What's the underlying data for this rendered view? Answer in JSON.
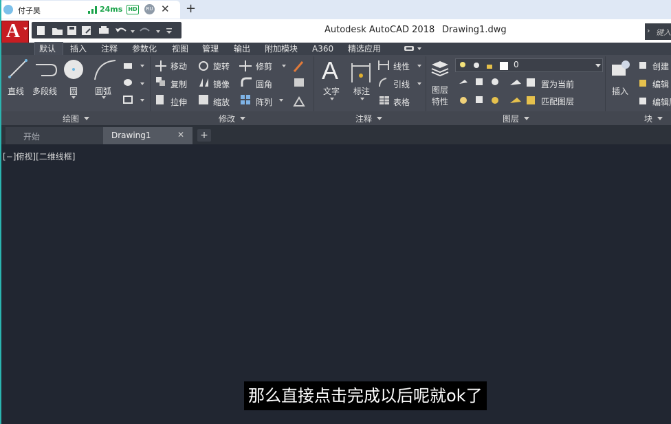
{
  "browser": {
    "tab_title": "付子昊",
    "latency": "24ms",
    "hd_badge": "HD",
    "region_badge": "RU",
    "close_glyph": "✕",
    "new_tab_glyph": "+"
  },
  "title_bar": {
    "app_title": "Autodesk AutoCAD 2018",
    "document_title": "Drawing1.dwg",
    "app_button_letter": "A",
    "search_placeholder": "键入"
  },
  "ribbon": {
    "tabs": [
      "默认",
      "插入",
      "注释",
      "参数化",
      "视图",
      "管理",
      "输出",
      "附加模块",
      "A360",
      "精选应用"
    ],
    "active_tab": "默认",
    "draw_panel": {
      "title": "绘图",
      "line": "直线",
      "polyline": "多段线",
      "circle": "圆",
      "arc": "圆弧"
    },
    "modify_panel": {
      "title": "修改",
      "move": "移动",
      "rotate": "旋转",
      "trim": "修剪",
      "copy": "复制",
      "mirror": "镜像",
      "fillet": "圆角",
      "stretch": "拉伸",
      "scale": "缩放",
      "array": "阵列"
    },
    "annotation_panel": {
      "title": "注释",
      "text": "文字",
      "dimension": "标注",
      "linear": "线性",
      "leader": "引线",
      "table": "表格"
    },
    "layers_panel": {
      "title": "图层",
      "layer_properties_1": "图层",
      "layer_properties_2": "特性",
      "current_layer": "0",
      "set_current": "置为当前",
      "match_layer": "匹配图层"
    },
    "block_panel": {
      "title": "块",
      "insert": "插入",
      "create": "创建",
      "edit": "编辑",
      "edit_attributes": "编辑属"
    }
  },
  "document_tabs": {
    "start": "开始",
    "drawing": "Drawing1",
    "close_glyph": "✕",
    "add_glyph": "+"
  },
  "viewport": {
    "label": "[−]俯视][二维线框]"
  },
  "subtitle": "那么直接点击完成以后呢就ok了",
  "colors": {
    "canvas": "#212631",
    "ribbon": "#474b55",
    "app_button": "#c71d22",
    "accent": "#2bb5b0"
  }
}
